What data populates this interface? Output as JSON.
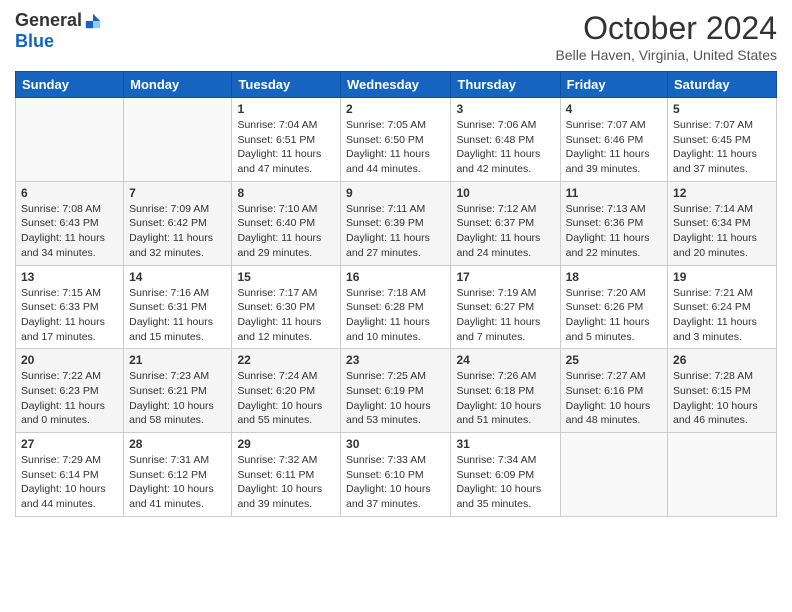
{
  "logo": {
    "general": "General",
    "blue": "Blue"
  },
  "title": "October 2024",
  "location": "Belle Haven, Virginia, United States",
  "days_of_week": [
    "Sunday",
    "Monday",
    "Tuesday",
    "Wednesday",
    "Thursday",
    "Friday",
    "Saturday"
  ],
  "weeks": [
    [
      {
        "day": "",
        "info": ""
      },
      {
        "day": "",
        "info": ""
      },
      {
        "day": "1",
        "info": "Sunrise: 7:04 AM\nSunset: 6:51 PM\nDaylight: 11 hours and 47 minutes."
      },
      {
        "day": "2",
        "info": "Sunrise: 7:05 AM\nSunset: 6:50 PM\nDaylight: 11 hours and 44 minutes."
      },
      {
        "day": "3",
        "info": "Sunrise: 7:06 AM\nSunset: 6:48 PM\nDaylight: 11 hours and 42 minutes."
      },
      {
        "day": "4",
        "info": "Sunrise: 7:07 AM\nSunset: 6:46 PM\nDaylight: 11 hours and 39 minutes."
      },
      {
        "day": "5",
        "info": "Sunrise: 7:07 AM\nSunset: 6:45 PM\nDaylight: 11 hours and 37 minutes."
      }
    ],
    [
      {
        "day": "6",
        "info": "Sunrise: 7:08 AM\nSunset: 6:43 PM\nDaylight: 11 hours and 34 minutes."
      },
      {
        "day": "7",
        "info": "Sunrise: 7:09 AM\nSunset: 6:42 PM\nDaylight: 11 hours and 32 minutes."
      },
      {
        "day": "8",
        "info": "Sunrise: 7:10 AM\nSunset: 6:40 PM\nDaylight: 11 hours and 29 minutes."
      },
      {
        "day": "9",
        "info": "Sunrise: 7:11 AM\nSunset: 6:39 PM\nDaylight: 11 hours and 27 minutes."
      },
      {
        "day": "10",
        "info": "Sunrise: 7:12 AM\nSunset: 6:37 PM\nDaylight: 11 hours and 24 minutes."
      },
      {
        "day": "11",
        "info": "Sunrise: 7:13 AM\nSunset: 6:36 PM\nDaylight: 11 hours and 22 minutes."
      },
      {
        "day": "12",
        "info": "Sunrise: 7:14 AM\nSunset: 6:34 PM\nDaylight: 11 hours and 20 minutes."
      }
    ],
    [
      {
        "day": "13",
        "info": "Sunrise: 7:15 AM\nSunset: 6:33 PM\nDaylight: 11 hours and 17 minutes."
      },
      {
        "day": "14",
        "info": "Sunrise: 7:16 AM\nSunset: 6:31 PM\nDaylight: 11 hours and 15 minutes."
      },
      {
        "day": "15",
        "info": "Sunrise: 7:17 AM\nSunset: 6:30 PM\nDaylight: 11 hours and 12 minutes."
      },
      {
        "day": "16",
        "info": "Sunrise: 7:18 AM\nSunset: 6:28 PM\nDaylight: 11 hours and 10 minutes."
      },
      {
        "day": "17",
        "info": "Sunrise: 7:19 AM\nSunset: 6:27 PM\nDaylight: 11 hours and 7 minutes."
      },
      {
        "day": "18",
        "info": "Sunrise: 7:20 AM\nSunset: 6:26 PM\nDaylight: 11 hours and 5 minutes."
      },
      {
        "day": "19",
        "info": "Sunrise: 7:21 AM\nSunset: 6:24 PM\nDaylight: 11 hours and 3 minutes."
      }
    ],
    [
      {
        "day": "20",
        "info": "Sunrise: 7:22 AM\nSunset: 6:23 PM\nDaylight: 11 hours and 0 minutes."
      },
      {
        "day": "21",
        "info": "Sunrise: 7:23 AM\nSunset: 6:21 PM\nDaylight: 10 hours and 58 minutes."
      },
      {
        "day": "22",
        "info": "Sunrise: 7:24 AM\nSunset: 6:20 PM\nDaylight: 10 hours and 55 minutes."
      },
      {
        "day": "23",
        "info": "Sunrise: 7:25 AM\nSunset: 6:19 PM\nDaylight: 10 hours and 53 minutes."
      },
      {
        "day": "24",
        "info": "Sunrise: 7:26 AM\nSunset: 6:18 PM\nDaylight: 10 hours and 51 minutes."
      },
      {
        "day": "25",
        "info": "Sunrise: 7:27 AM\nSunset: 6:16 PM\nDaylight: 10 hours and 48 minutes."
      },
      {
        "day": "26",
        "info": "Sunrise: 7:28 AM\nSunset: 6:15 PM\nDaylight: 10 hours and 46 minutes."
      }
    ],
    [
      {
        "day": "27",
        "info": "Sunrise: 7:29 AM\nSunset: 6:14 PM\nDaylight: 10 hours and 44 minutes."
      },
      {
        "day": "28",
        "info": "Sunrise: 7:31 AM\nSunset: 6:12 PM\nDaylight: 10 hours and 41 minutes."
      },
      {
        "day": "29",
        "info": "Sunrise: 7:32 AM\nSunset: 6:11 PM\nDaylight: 10 hours and 39 minutes."
      },
      {
        "day": "30",
        "info": "Sunrise: 7:33 AM\nSunset: 6:10 PM\nDaylight: 10 hours and 37 minutes."
      },
      {
        "day": "31",
        "info": "Sunrise: 7:34 AM\nSunset: 6:09 PM\nDaylight: 10 hours and 35 minutes."
      },
      {
        "day": "",
        "info": ""
      },
      {
        "day": "",
        "info": ""
      }
    ]
  ]
}
